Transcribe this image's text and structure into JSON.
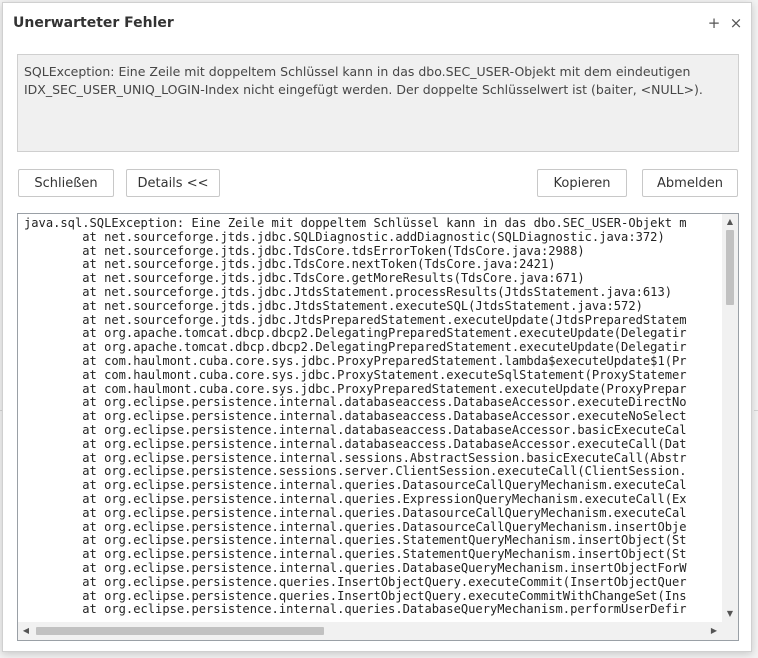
{
  "dialog": {
    "title": "Unerwarteter Fehler",
    "maximize_icon": "plus-icon",
    "close_icon": "close-icon",
    "maximize_glyph": "+",
    "close_glyph": "×"
  },
  "message": {
    "line1": "SQLException: Eine Zeile mit doppeltem Schlüssel kann in das dbo.SEC_USER-Objekt mit dem eindeutigen",
    "line2": "IDX_SEC_USER_UNIQ_LOGIN-Index nicht eingefügt werden. Der doppelte Schlüsselwert ist (baiter, <NULL>)."
  },
  "buttons": {
    "close": "Schließen",
    "details": "Details <<",
    "copy": "Kopieren",
    "logout": "Abmelden"
  },
  "stacktrace": [
    "java.sql.SQLException: Eine Zeile mit doppeltem Schlüssel kann in das dbo.SEC_USER-Objekt m",
    "\tat net.sourceforge.jtds.jdbc.SQLDiagnostic.addDiagnostic(SQLDiagnostic.java:372)",
    "\tat net.sourceforge.jtds.jdbc.TdsCore.tdsErrorToken(TdsCore.java:2988)",
    "\tat net.sourceforge.jtds.jdbc.TdsCore.nextToken(TdsCore.java:2421)",
    "\tat net.sourceforge.jtds.jdbc.TdsCore.getMoreResults(TdsCore.java:671)",
    "\tat net.sourceforge.jtds.jdbc.JtdsStatement.processResults(JtdsStatement.java:613)",
    "\tat net.sourceforge.jtds.jdbc.JtdsStatement.executeSQL(JtdsStatement.java:572)",
    "\tat net.sourceforge.jtds.jdbc.JtdsPreparedStatement.executeUpdate(JtdsPreparedStatem",
    "\tat org.apache.tomcat.dbcp.dbcp2.DelegatingPreparedStatement.executeUpdate(Delegatir",
    "\tat org.apache.tomcat.dbcp.dbcp2.DelegatingPreparedStatement.executeUpdate(Delegatir",
    "\tat com.haulmont.cuba.core.sys.jdbc.ProxyPreparedStatement.lambda$executeUpdate$1(Pr",
    "\tat com.haulmont.cuba.core.sys.jdbc.ProxyStatement.executeSqlStatement(ProxyStatemer",
    "\tat com.haulmont.cuba.core.sys.jdbc.ProxyPreparedStatement.executeUpdate(ProxyPrepar",
    "\tat org.eclipse.persistence.internal.databaseaccess.DatabaseAccessor.executeDirectNo",
    "\tat org.eclipse.persistence.internal.databaseaccess.DatabaseAccessor.executeNoSelect",
    "\tat org.eclipse.persistence.internal.databaseaccess.DatabaseAccessor.basicExecuteCal",
    "\tat org.eclipse.persistence.internal.databaseaccess.DatabaseAccessor.executeCall(Dat",
    "\tat org.eclipse.persistence.internal.sessions.AbstractSession.basicExecuteCall(Abstr",
    "\tat org.eclipse.persistence.sessions.server.ClientSession.executeCall(ClientSession.",
    "\tat org.eclipse.persistence.internal.queries.DatasourceCallQueryMechanism.executeCal",
    "\tat org.eclipse.persistence.internal.queries.ExpressionQueryMechanism.executeCall(Ex",
    "\tat org.eclipse.persistence.internal.queries.DatasourceCallQueryMechanism.executeCal",
    "\tat org.eclipse.persistence.internal.queries.DatasourceCallQueryMechanism.insertObje",
    "\tat org.eclipse.persistence.internal.queries.StatementQueryMechanism.insertObject(St",
    "\tat org.eclipse.persistence.internal.queries.StatementQueryMechanism.insertObject(St",
    "\tat org.eclipse.persistence.internal.queries.DatabaseQueryMechanism.insertObjectForW",
    "\tat org.eclipse.persistence.queries.InsertObjectQuery.executeCommit(InsertObjectQuer",
    "\tat org.eclipse.persistence.queries.InsertObjectQuery.executeCommitWithChangeSet(Ins",
    "\tat org.eclipse.persistence.internal.queries.DatabaseQueryMechanism.performUserDefir"
  ]
}
